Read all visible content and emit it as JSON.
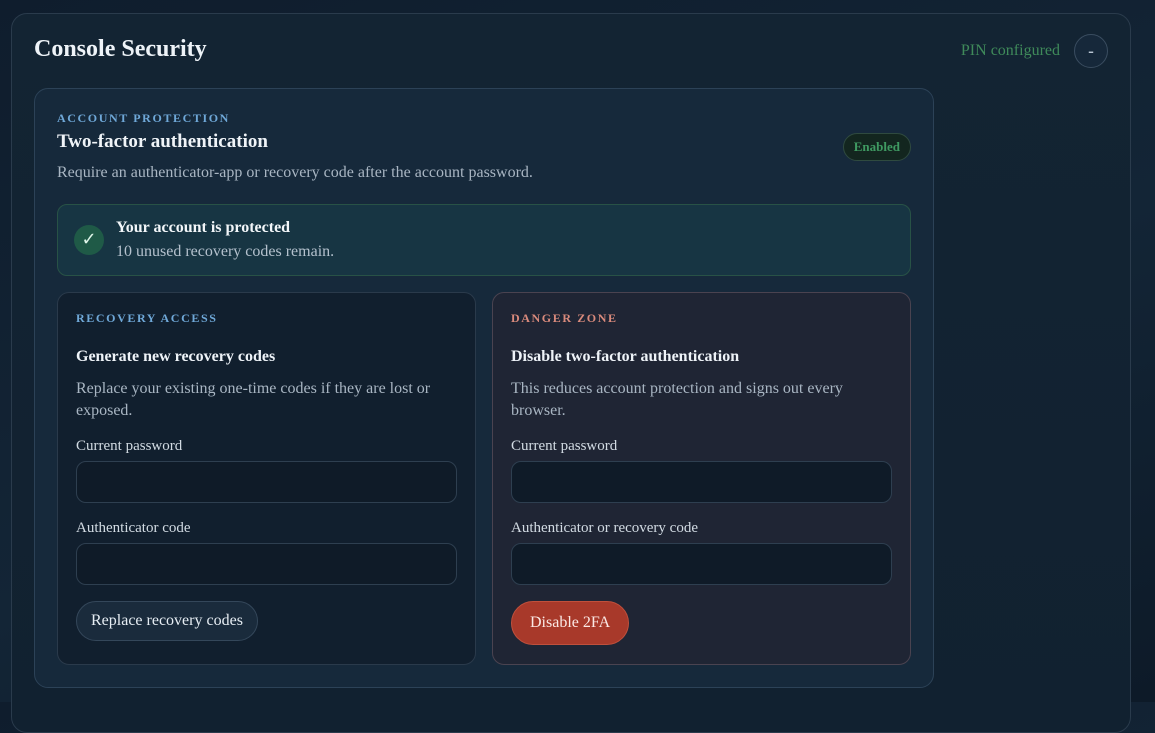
{
  "header": {
    "title": "Console Security",
    "pin_status": "PIN configured",
    "collapse_label": "-"
  },
  "card": {
    "eyebrow": "ACCOUNT PROTECTION",
    "title": "Two-factor authentication",
    "description": "Require an authenticator-app or recovery code after the account password.",
    "badge": "Enabled"
  },
  "alert": {
    "icon": "check-icon",
    "glyph": "✓",
    "title": "Your account is protected",
    "text": "10 unused recovery codes remain."
  },
  "recovery": {
    "eyebrow": "RECOVERY ACCESS",
    "title": "Generate new recovery codes",
    "description": "Replace your existing one-time codes if they are lost or exposed.",
    "password_label": "Current password",
    "password_value": "",
    "code_label": "Authenticator code",
    "code_value": "",
    "button_label": "Replace recovery codes"
  },
  "danger": {
    "eyebrow": "DANGER ZONE",
    "title": "Disable two-factor authentication",
    "description": "This reduces account protection and signs out every browser.",
    "password_label": "Current password",
    "password_value": "",
    "code_label": "Authenticator or recovery code",
    "code_value": "",
    "button_label": "Disable 2FA"
  },
  "colors": {
    "accent": "#6fa8d8",
    "success": "#3f9a62",
    "danger": "#a8392a"
  }
}
